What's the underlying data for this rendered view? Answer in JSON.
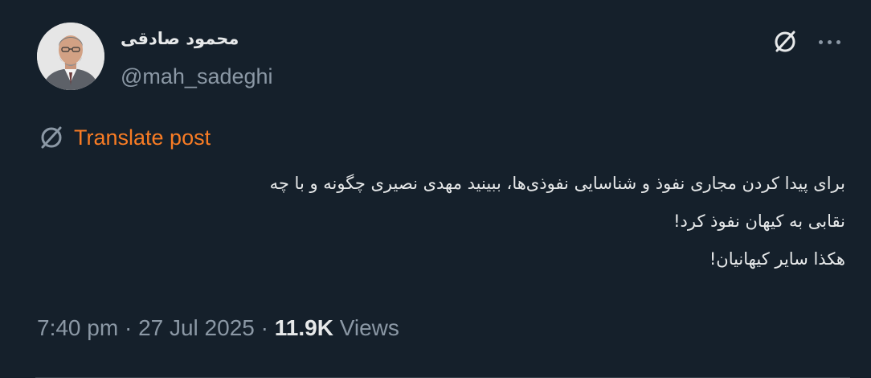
{
  "author": {
    "display_name": "محمود صادقی",
    "handle": "@mah_sadeghi"
  },
  "actions": {
    "grok_icon": "grok-slash-circle-icon",
    "more_icon": "more-horizontal-icon"
  },
  "translate": {
    "label": "Translate post",
    "icon": "translate-globe-icon",
    "color": "#f97c24"
  },
  "tweet": {
    "lines": [
      "برای پیدا کردن مجاری نفوذ و شناسایی نفوذی‌ها، ببینید مهدی نصیری چگونه و با چه",
      "نقابی به کیهان نفوذ کرد!",
      "هکذا سایر کیهانیان!"
    ]
  },
  "meta": {
    "time": "7:40 pm",
    "separator": " · ",
    "date": "27 Jul 2025",
    "views_count": "11.9K",
    "views_label": "Views"
  },
  "theme": {
    "background": "#15202b",
    "text_primary": "#e7e9ea",
    "text_secondary": "#8b98a5"
  }
}
